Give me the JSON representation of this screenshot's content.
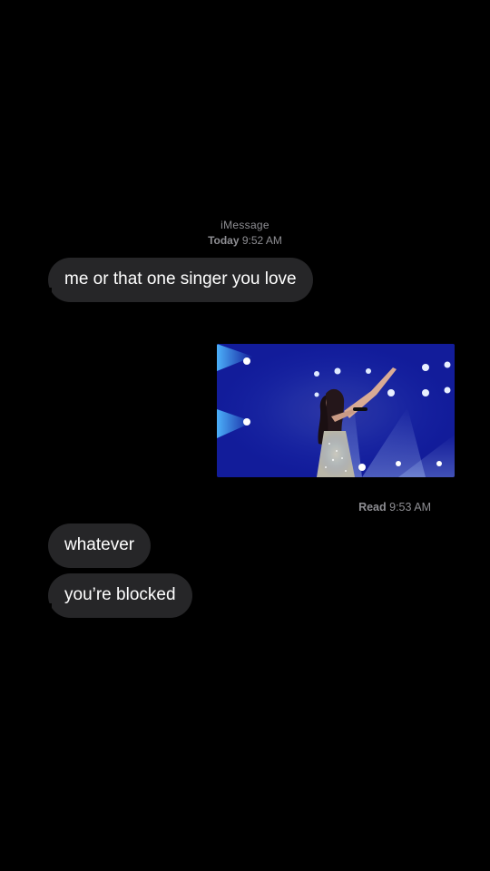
{
  "header": {
    "service": "iMessage",
    "timestamp_day": "Today",
    "timestamp_time": "9:52 AM"
  },
  "messages": [
    {
      "direction": "incoming",
      "type": "text",
      "text": "me or that one singer you love"
    },
    {
      "direction": "outgoing",
      "type": "image",
      "description_icon": "photo-of-singer-on-stage"
    },
    {
      "direction": "incoming",
      "type": "text",
      "text": "whatever"
    },
    {
      "direction": "incoming",
      "type": "text",
      "text": "you’re blocked"
    }
  ],
  "receipt": {
    "label": "Read",
    "time": "9:53 AM"
  },
  "colors": {
    "background": "#000000",
    "incoming_bubble": "#262628",
    "meta_text": "#8e8e93",
    "stage_blue": "#1a2ad0"
  }
}
